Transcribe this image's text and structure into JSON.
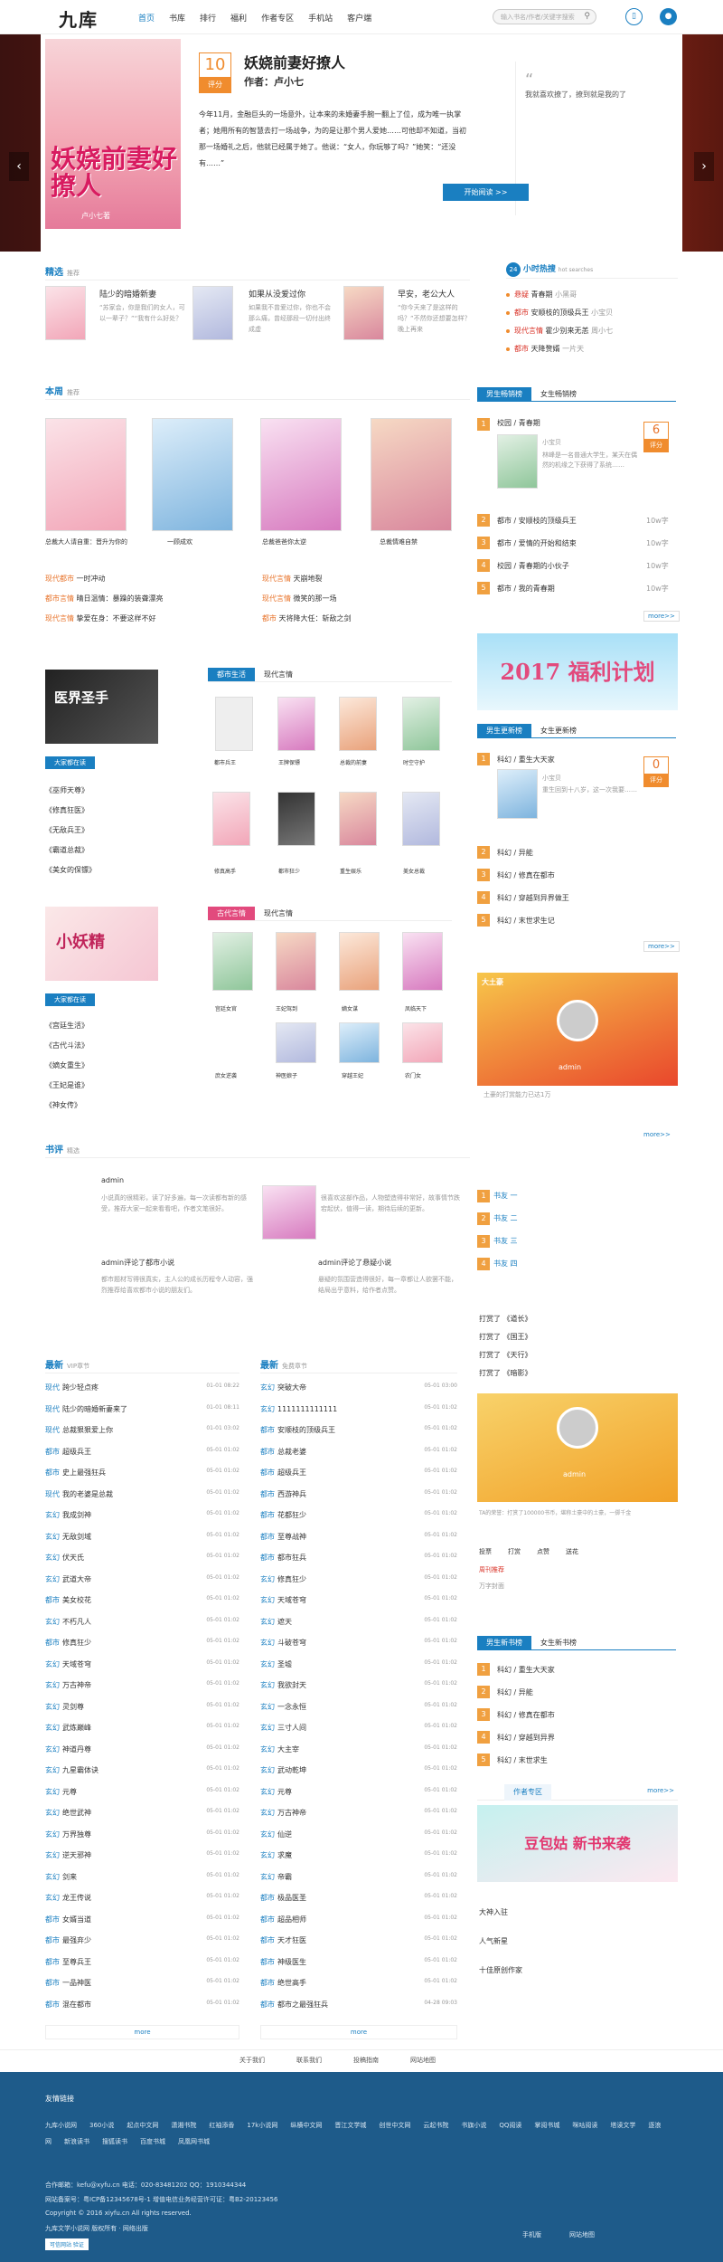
{
  "header": {
    "logo": "九库",
    "nav": [
      "首页",
      "书库",
      "排行",
      "福利",
      "作者专区",
      "手机站",
      "客户端"
    ],
    "search_placeholder": "输入书名/作者/关键字搜索",
    "search_icon": "search-icon"
  },
  "banner": {
    "cover_title": "妖娆前妻好撩人",
    "cover_author": "卢小七著",
    "score": "10",
    "score_label": "评分",
    "title": "妖娆前妻好撩人",
    "author": "作者：卢小七",
    "desc": "今年11月，金融巨头的一场意外，让本来的未婚妻手腕一翻上了位，成为唯一执掌者；她用所有的智慧去打一场战争，为的是让那个男人爱她……可他却不知道，当初那一场婚礼之后，他就已经属于她了。他说：“女人，你玩够了吗？”她笑：“还没有……”",
    "quote": "我就喜欢撩了，撩到就是我的了",
    "btn": "开始阅读 >>"
  },
  "recommend": {
    "title": "精选",
    "sub": "推荐",
    "items": [
      {
        "name": "陆少的暗婚新妻",
        "desc": "“苏家会，你是我们的女人，可以一辈子？”“我有什么好处？"
      },
      {
        "name": "如果从没爱过你",
        "desc": "如果我不曾爱过你，你也不会那么痛，曾经那段一切付出终成虚"
      },
      {
        "name": "早安，老公大人",
        "desc": "“你今天来了是这样的吗？”不然你还想要怎样？晚上再来"
      }
    ],
    "hot": {
      "title": "小时热搜",
      "sub": "hot searches",
      "badge": "24",
      "rows": [
        [
          "悬疑",
          "青春期",
          "小黑哥"
        ],
        [
          "都市",
          "安顺枝的顶级兵王",
          "小宝贝"
        ],
        [
          "现代言情",
          "霍少别来无恙",
          "周小七"
        ],
        [
          "都市",
          "天降赘婿",
          "一片天"
        ]
      ]
    }
  },
  "week": {
    "title": "本周",
    "sub": "推荐",
    "books": [
      {
        "name": "总裁大人请自重：晋升为你的"
      },
      {
        "name": "一顾成欢"
      },
      {
        "name": "总裁爸爸你太逆"
      },
      {
        "name": "总裁情难自禁"
      }
    ],
    "list": [
      [
        "现代都市",
        "一时冲动"
      ],
      [
        "都市言情",
        "晴日温情：暴躁的装聋漂亮"
      ],
      [
        "现代言情",
        "挚爱在身：不要这样不好"
      ],
      [
        "现代言情",
        "天崩地裂"
      ],
      [
        "现代言情",
        "微笑的那一场"
      ],
      [
        "都市",
        "天将降大任：斩敌之剑"
      ]
    ]
  },
  "rank1": {
    "tabs": [
      "男生畅销榜",
      "女生畅销榜"
    ],
    "top": {
      "genre": "校园",
      "name": "青春期",
      "author": "小宝贝",
      "score": "6",
      "score_label": "评分",
      "desc": "林峰是一名普通大学生，某天在偶然的机缘之下获得了系统……"
    },
    "rows": [
      [
        "都市",
        "安顺枝的顶级兵王",
        "10w字"
      ],
      [
        "都市",
        "爱情的开始和结束",
        "10w字"
      ],
      [
        "校园",
        "青春期的小伙子",
        "10w字"
      ],
      [
        "都市",
        "我的青春期",
        "10w字"
      ]
    ],
    "more": "more>>"
  },
  "promo": {
    "text": "2017 福利计划"
  },
  "mid": {
    "tabs": [
      "都市生活",
      "现代言情"
    ],
    "hot_label": "大家都在读",
    "cover_text": "医界圣手",
    "books": [
      "都市兵王",
      "王牌保镖",
      "总裁的前妻",
      "时空守护",
      "修真高手",
      "都市狂少",
      "重生娱乐",
      "美女总裁",
      "特种兵王",
      "超级兵王"
    ],
    "list": [
      "《巫师天尊》",
      "《修真狂医》",
      "《无敌兵王》",
      "《霸道总裁》",
      "《美女的保镖》"
    ]
  },
  "rank2": {
    "tabs": [
      "男生更新榜",
      "女生更新榜"
    ],
    "top": {
      "genre": "科幻",
      "name": "重生大天家",
      "author": "小宝贝",
      "score": "0",
      "score_label": "评分",
      "desc": "重生回到十八岁，这一次我要……"
    },
    "rows": [
      [
        "科幻",
        "异能"
      ],
      [
        "科幻",
        "修真在都市"
      ],
      [
        "科幻",
        "穿越到异界做王"
      ],
      [
        "科幻",
        "末世求生记"
      ]
    ],
    "more": "more>>"
  },
  "sect3": {
    "tabs": [
      "古代言情",
      "现代言情"
    ],
    "hot_label": "大家都在读",
    "cover_text": "小妖精",
    "books": [
      "宫廷女官",
      "王妃驾到",
      "嫡女谋",
      "凤临天下",
      "庶女逆袭",
      "神医娘子",
      "穿越王妃",
      "农门女"
    ],
    "list": [
      "《宫廷生活》",
      "《古代斗法》",
      "《嫡女重生》",
      "《王妃是谁》",
      "《神女传》"
    ],
    "more": "more>>"
  },
  "reader": {
    "title": "书评",
    "sub": "精选",
    "comments": [
      {
        "user": "admin",
        "text": "小说真的很精彩，读了好多遍，每一次读都有新的感受，推荐大家一起来看看吧，作者文笔很好。"
      },
      {
        "user": "admin",
        "text": "很喜欢这部作品，人物塑造得非常好，故事情节跌宕起伏，值得一读，期待后续的更新。"
      },
      {
        "user": "admin评论了都市小说",
        "text": "都市题材写得很真实，主人公的成长历程令人动容，强烈推荐给喜欢都市小说的朋友们。"
      },
      {
        "user": "admin评论了悬疑小说",
        "text": "悬疑的氛围营造得很好，每一章都让人欲罢不能，结局出乎意料，给作者点赞。"
      }
    ]
  },
  "fans": {
    "title": "大土豪",
    "user": "admin",
    "text": "土豪的打赏能力已达1万",
    "rows": [
      "书友 一",
      "书友 二",
      "书友 三",
      "书友 四"
    ],
    "more": "more>>",
    "tags": [
      "打赏了 《道长》",
      "打赏了 《国王》",
      "打赏了 《天行》",
      "打赏了 《暗影》"
    ]
  },
  "latest_vip": {
    "title": "最新",
    "sub": "VIP章节",
    "rows": [
      [
        "现代",
        "跨少轻点疼",
        "01-01 08:22"
      ],
      [
        "现代",
        "陆少的暗婚新妻来了",
        "01-01 08:11"
      ],
      [
        "现代",
        "总裁狠狠爱上你",
        "01-01 03:02"
      ],
      [
        "都市",
        "超级兵王",
        "05-01 01:02"
      ],
      [
        "都市",
        "史上最强狂兵",
        "05-01 01:02"
      ],
      [
        "现代",
        "我的老婆是总裁",
        "05-01 01:02"
      ],
      [
        "玄幻",
        "我成剑神",
        "05-01 01:02"
      ],
      [
        "玄幻",
        "无敌剑域",
        "05-01 01:02"
      ],
      [
        "玄幻",
        "伏天氏",
        "05-01 01:02"
      ],
      [
        "玄幻",
        "武道大帝",
        "05-01 01:02"
      ],
      [
        "都市",
        "美女校花",
        "05-01 01:02"
      ],
      [
        "玄幻",
        "不朽凡人",
        "05-01 01:02"
      ],
      [
        "都市",
        "修真狂少",
        "05-01 01:02"
      ],
      [
        "玄幻",
        "天域苍穹",
        "05-01 01:02"
      ],
      [
        "玄幻",
        "万古神帝",
        "05-01 01:02"
      ],
      [
        "玄幻",
        "灵剑尊",
        "05-01 01:02"
      ],
      [
        "玄幻",
        "武炼巅峰",
        "05-01 01:02"
      ],
      [
        "玄幻",
        "神道丹尊",
        "05-01 01:02"
      ],
      [
        "玄幻",
        "九星霸体诀",
        "05-01 01:02"
      ],
      [
        "玄幻",
        "元尊",
        "05-01 01:02"
      ],
      [
        "玄幻",
        "绝世武神",
        "05-01 01:02"
      ],
      [
        "玄幻",
        "万界独尊",
        "05-01 01:02"
      ],
      [
        "玄幻",
        "逆天邪神",
        "05-01 01:02"
      ],
      [
        "玄幻",
        "剑来",
        "05-01 01:02"
      ],
      [
        "玄幻",
        "龙王传说",
        "05-01 01:02"
      ],
      [
        "都市",
        "女婿当道",
        "05-01 01:02"
      ],
      [
        "都市",
        "最强弃少",
        "05-01 01:02"
      ],
      [
        "都市",
        "至尊兵王",
        "05-01 01:02"
      ],
      [
        "都市",
        "一品神医",
        "05-01 01:02"
      ],
      [
        "都市",
        "混在都市",
        "05-01 01:02"
      ]
    ],
    "more": "more"
  },
  "latest_free": {
    "title": "最新",
    "sub": "免费章节",
    "rows": [
      [
        "玄幻",
        "突破大帝",
        "05-01 03:00"
      ],
      [
        "玄幻",
        "1111111111111",
        "05-01 01:02"
      ],
      [
        "都市",
        "安顺枝的顶级兵王",
        "05-01 01:02"
      ],
      [
        "都市",
        "总裁老婆",
        "05-01 01:02"
      ],
      [
        "都市",
        "超级兵王",
        "05-01 01:02"
      ],
      [
        "都市",
        "西游神兵",
        "05-01 01:02"
      ],
      [
        "都市",
        "花都狂少",
        "05-01 01:02"
      ],
      [
        "都市",
        "至尊战神",
        "05-01 01:02"
      ],
      [
        "都市",
        "都市狂兵",
        "05-01 01:02"
      ],
      [
        "玄幻",
        "修真狂少",
        "05-01 01:02"
      ],
      [
        "玄幻",
        "天域苍穹",
        "05-01 01:02"
      ],
      [
        "玄幻",
        "遮天",
        "05-01 01:02"
      ],
      [
        "玄幻",
        "斗破苍穹",
        "05-01 01:02"
      ],
      [
        "玄幻",
        "圣墟",
        "05-01 01:02"
      ],
      [
        "玄幻",
        "我欲封天",
        "05-01 01:02"
      ],
      [
        "玄幻",
        "一念永恒",
        "05-01 01:02"
      ],
      [
        "玄幻",
        "三寸人间",
        "05-01 01:02"
      ],
      [
        "玄幻",
        "大主宰",
        "05-01 01:02"
      ],
      [
        "玄幻",
        "武动乾坤",
        "05-01 01:02"
      ],
      [
        "玄幻",
        "元尊",
        "05-01 01:02"
      ],
      [
        "玄幻",
        "万古神帝",
        "05-01 01:02"
      ],
      [
        "玄幻",
        "仙逆",
        "05-01 01:02"
      ],
      [
        "玄幻",
        "求魔",
        "05-01 01:02"
      ],
      [
        "玄幻",
        "帝霸",
        "05-01 01:02"
      ],
      [
        "都市",
        "极品医圣",
        "05-01 01:02"
      ],
      [
        "都市",
        "超品相师",
        "05-01 01:02"
      ],
      [
        "都市",
        "天才狂医",
        "05-01 01:02"
      ],
      [
        "都市",
        "神级医生",
        "05-01 01:02"
      ],
      [
        "都市",
        "绝世高手",
        "05-01 01:02"
      ],
      [
        "都市",
        "都市之最强狂兵",
        "04-28 09:03"
      ]
    ],
    "more": "more"
  },
  "side2": {
    "user": "admin",
    "text": "TA的荣誉：打赏了100000书币，堪称土豪中的土豪，一掷千金",
    "stats": [
      "投票",
      "打赏",
      "点赞",
      "送花"
    ],
    "tags": [
      "周刊推荐",
      "万字封面"
    ],
    "rank3_tabs": [
      "男生新书榜",
      "女生新书榜"
    ],
    "rank3": [
      [
        "科幻",
        "重生大天家"
      ],
      [
        "科幻",
        "异能"
      ],
      [
        "科幻",
        "修真在都市"
      ],
      [
        "科幻",
        "穿越到异界"
      ],
      [
        "科幻",
        "末世求生"
      ]
    ],
    "author_title": "作者专区",
    "author_more": "more>>",
    "author_promo": "豆包姑 新书来袭",
    "links": [
      "大神入驻",
      "人气新星",
      "十佳原创作家"
    ]
  },
  "footer_nav": [
    "关于我们",
    "联系我们",
    "投稿指南",
    "网站地图"
  ],
  "footer": {
    "title": "友情链接",
    "links": [
      "九库小说网",
      "360小说",
      "起点中文网",
      "潇湘书院",
      "红袖添香",
      "17k小说网",
      "纵横中文网",
      "晋江文学城",
      "创世中文网",
      "云起书院",
      "书旗小说",
      "QQ阅读",
      "掌阅书城",
      "咪咕阅读",
      "塔读文学",
      "逐浪网",
      "新浪读书",
      "搜狐读书",
      "百度书城",
      "凤凰网书城"
    ],
    "line1": "合作邮箱：kefu@xyfu.cn 电话：020-83481202 QQ：1910344344",
    "line2": "网站备案号：粤ICP备12345678号-1 增值电信业务经营许可证：粤B2-20123456",
    "line3": "Copyright © 2016 xiyfu.cn All rights reserved.",
    "line4": "九库文学小说网 版权所有 · 网络出版",
    "badge": "可信网站 验证",
    "bottom_links": [
      "手机版",
      "网站地图"
    ]
  }
}
